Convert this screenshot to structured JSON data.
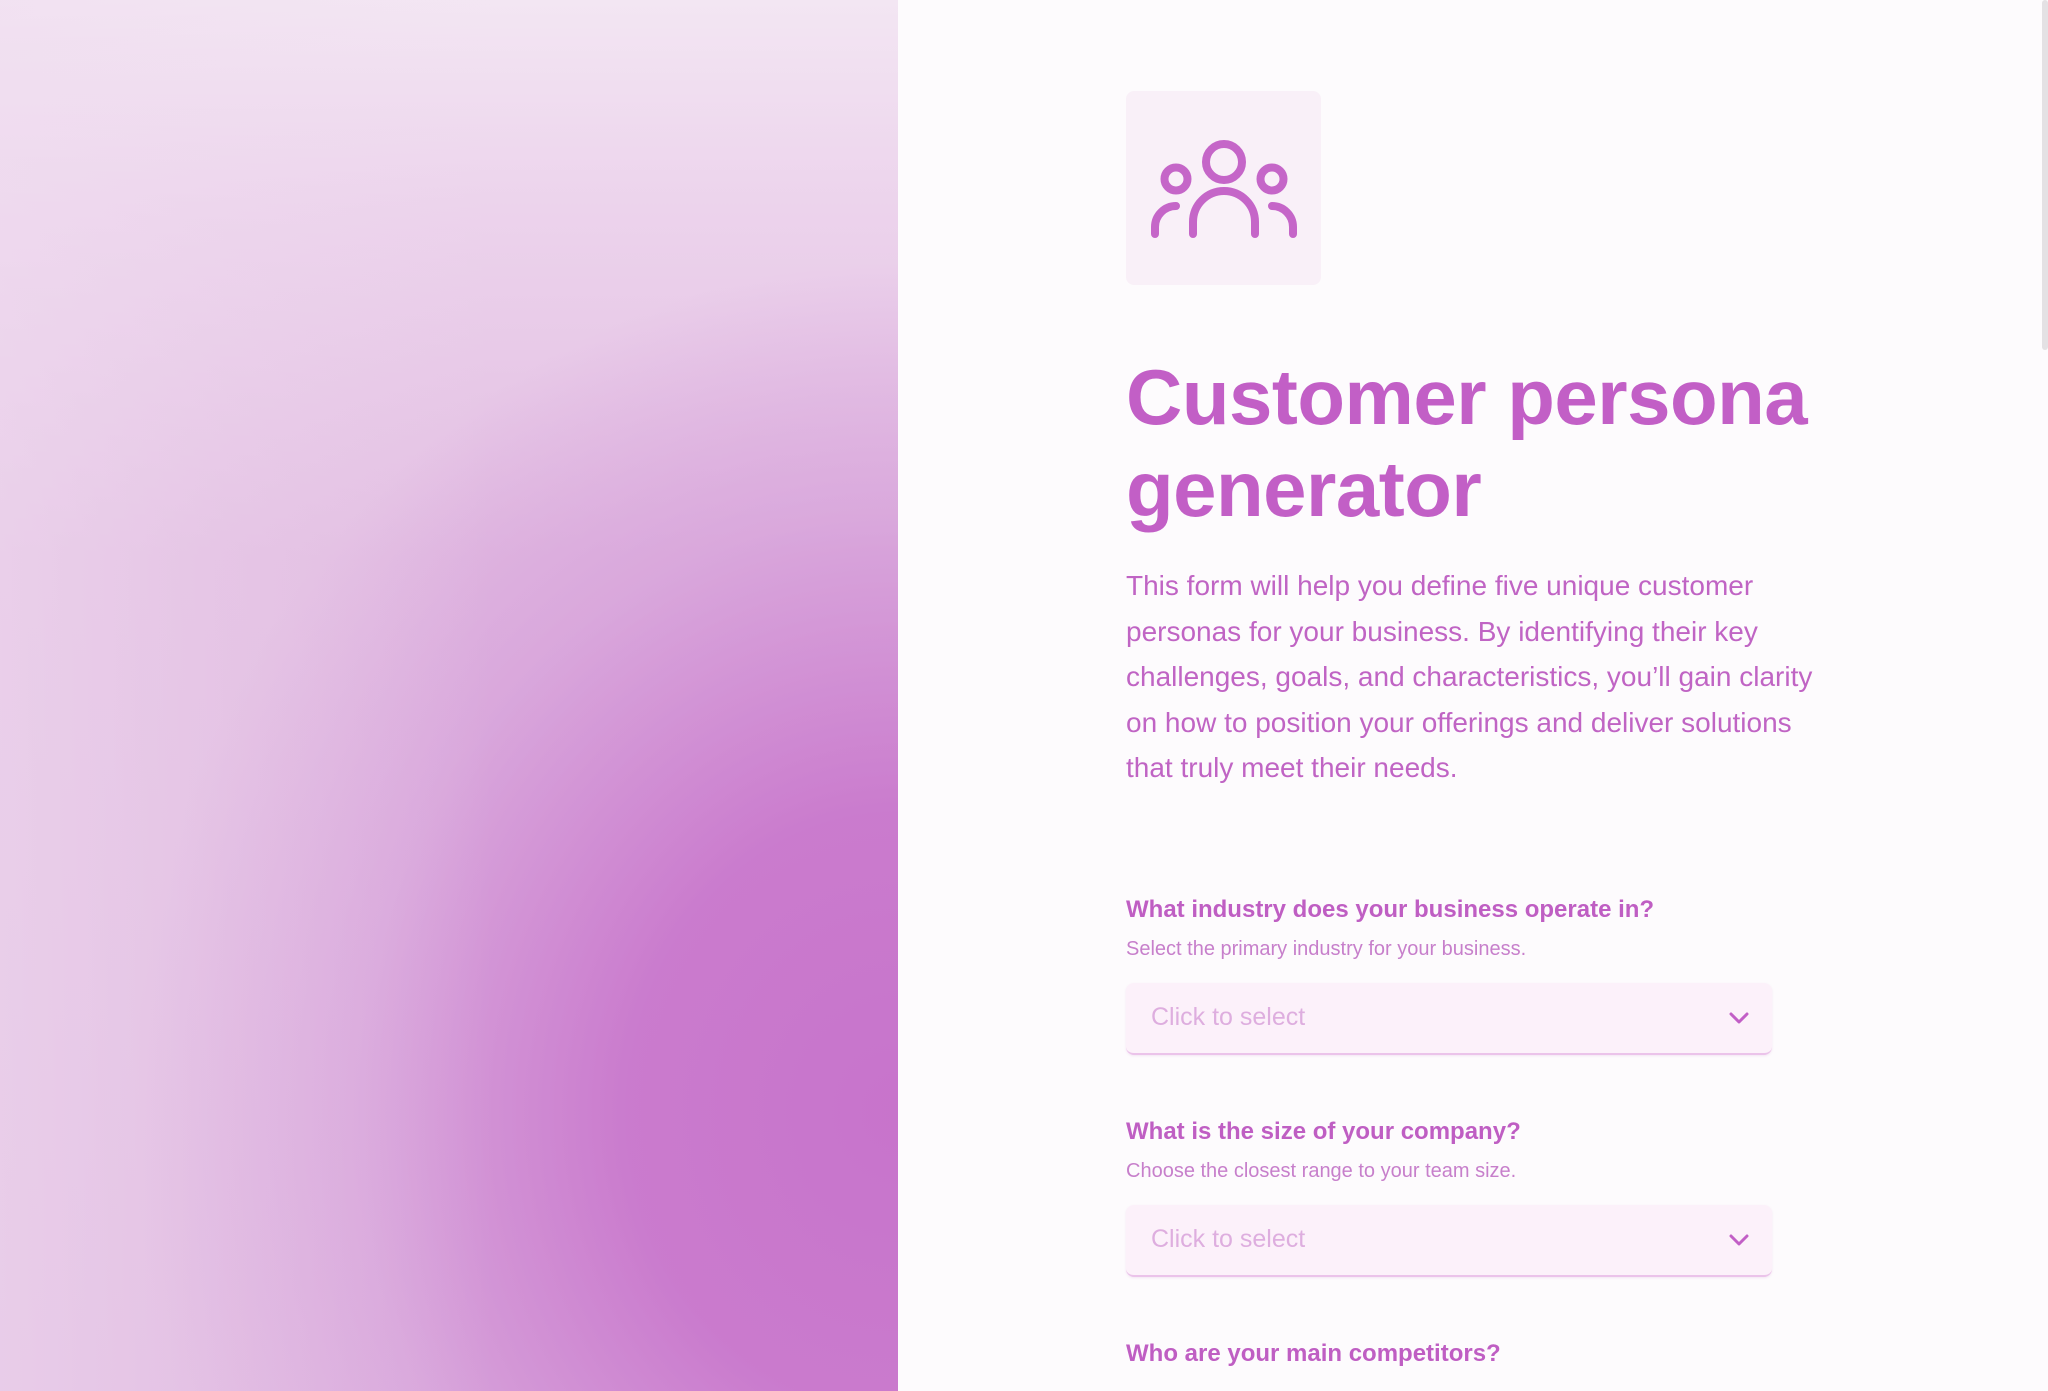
{
  "colors": {
    "accent": "#c25fc6",
    "select_background": "#fcf1fa",
    "placeholder": "#deaedf",
    "form_background": "#fdfbfd"
  },
  "logo": {
    "icon": "users-group-icon"
  },
  "title": "Customer persona generator",
  "description": "This form will help you define five unique customer personas for your business. By identifying their key challenges, goals, and characteristics, you’ll gain clarity on how to position your offerings and deliver solutions that truly meet their needs.",
  "questions": [
    {
      "label": "What industry does your business operate in?",
      "help": "Select the primary industry for your business.",
      "field": {
        "type": "select",
        "placeholder": "Click to select",
        "icon": "chevron-down-icon"
      }
    },
    {
      "label": "What is the size of your company?",
      "help": "Choose the closest range to your team size.",
      "field": {
        "type": "select",
        "placeholder": "Click to select",
        "icon": "chevron-down-icon"
      }
    },
    {
      "label": "Who are your main competitors?"
    }
  ]
}
